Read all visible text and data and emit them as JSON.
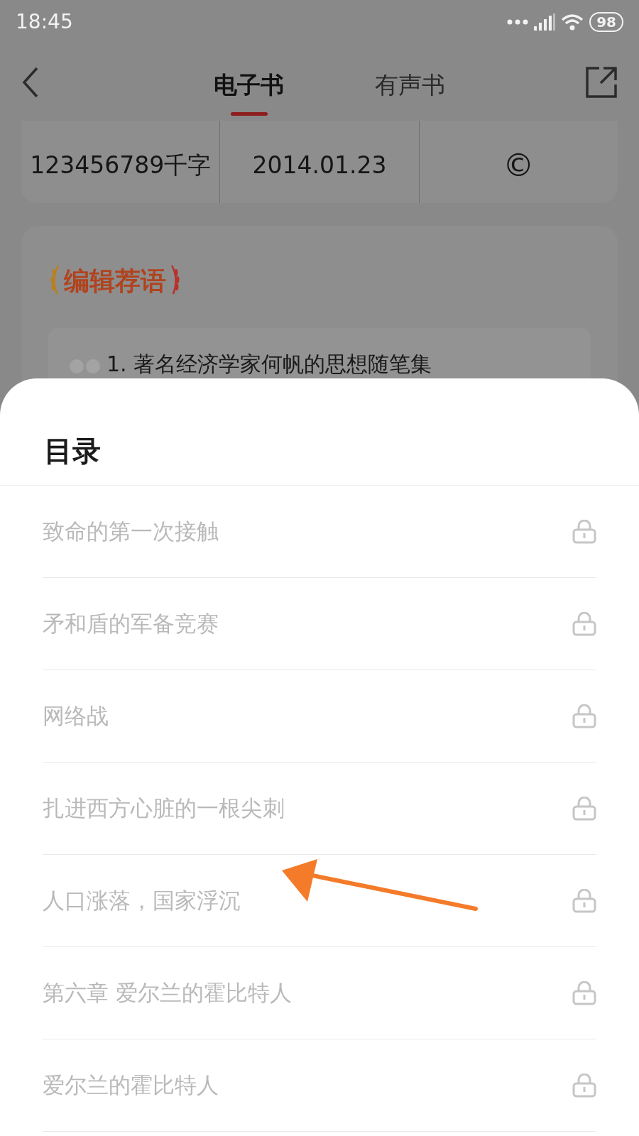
{
  "status_bar": {
    "time": "18:45",
    "battery": "98"
  },
  "tabs": [
    {
      "label": "电子书",
      "selected": true
    },
    {
      "label": "有声书",
      "selected": false
    }
  ],
  "stats": [
    {
      "value": "123456789千字"
    },
    {
      "value": "2014.01.23"
    },
    {
      "value": "©"
    }
  ],
  "editor_pick": {
    "title": "编辑荐语",
    "quote": "1. 著名经济学家何帆的思想随笔集"
  },
  "toc": {
    "title": "目录",
    "chapters": [
      {
        "title": "致命的第一次接触"
      },
      {
        "title": "矛和盾的军备竞赛"
      },
      {
        "title": "网络战"
      },
      {
        "title": "扎进西方心脏的一根尖刺"
      },
      {
        "title": "人口涨落，国家浮沉"
      },
      {
        "title": "第六章 爱尔兰的霍比特人"
      },
      {
        "title": "爱尔兰的霍比特人"
      }
    ]
  }
}
